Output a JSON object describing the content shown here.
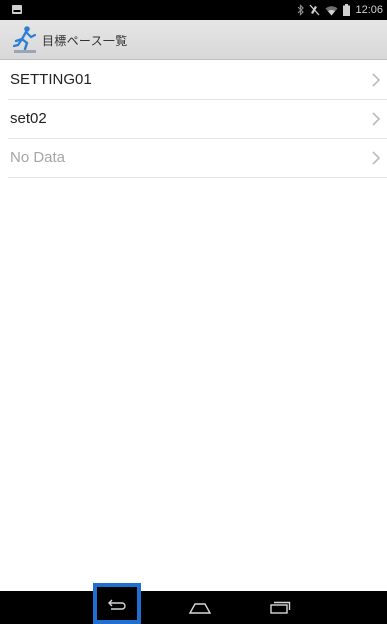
{
  "status_bar": {
    "time": "12:06",
    "icons": [
      "notification-icon",
      "bluetooth-icon",
      "mute-icon",
      "wifi-icon",
      "battery-icon"
    ]
  },
  "action_bar": {
    "title": "目標ペース一覧",
    "icon": "runner-icon",
    "accent": "#2b7fd4"
  },
  "list": {
    "items": [
      {
        "label": "SETTING01",
        "enabled": true
      },
      {
        "label": "set02",
        "enabled": true
      },
      {
        "label": "No Data",
        "enabled": false
      }
    ]
  },
  "nav_bar": {
    "buttons": [
      "back-icon",
      "home-icon",
      "recent-apps-icon"
    ],
    "highlight_color": "#1f6fd1"
  }
}
